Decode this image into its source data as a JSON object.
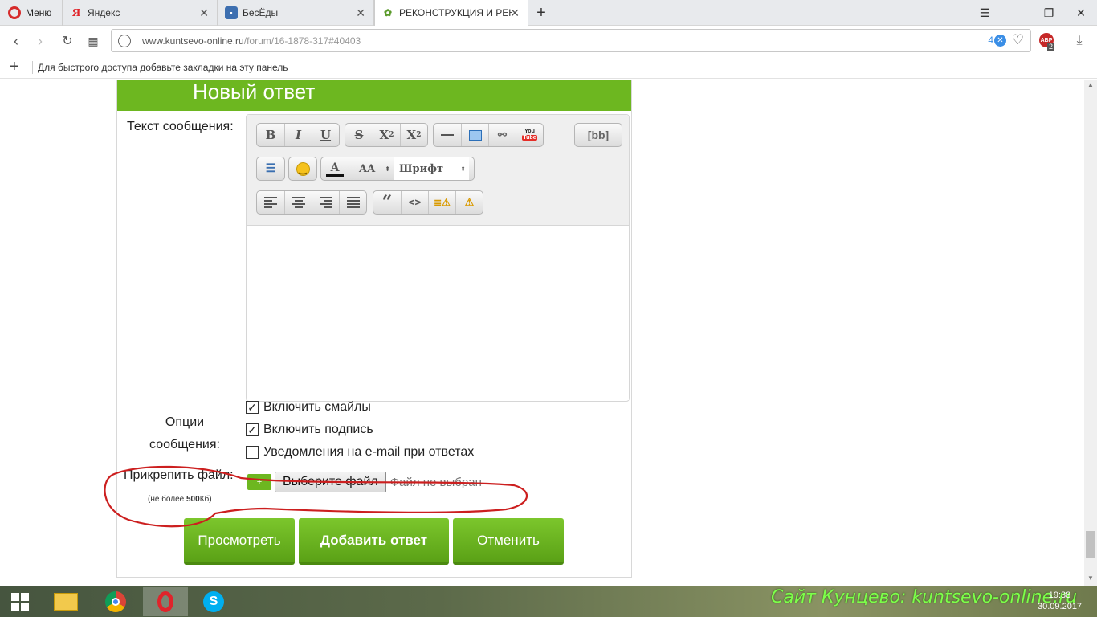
{
  "browser": {
    "menu_label": "Меню",
    "tabs": [
      {
        "label": "Яндекс"
      },
      {
        "label": "БесЁды"
      },
      {
        "label": "РЕКОНСТРУКЦИЯ И РЕНС"
      }
    ],
    "url_host": "www.kuntsevo-online.ru",
    "url_path": "/forum/16-1878-317#40403",
    "adblock_count": "4",
    "abp_badge": "ABP",
    "abp_count": "2",
    "bookmarks_hint": "Для быстрого доступа добавьте закладки на эту панель"
  },
  "form": {
    "header": "Новый ответ",
    "message_label": "Текст сообщения:",
    "toolbar": {
      "bold": "B",
      "italic": "I",
      "underline": "U",
      "strike": "S",
      "superscript": "X",
      "sup_mark": "2",
      "subscript": "X",
      "sub_mark": "2",
      "bb_mode": "[bb]",
      "font_size_label": "AA",
      "font_select": "Шрифт",
      "youtube_top": "You",
      "youtube_bottom": "Tube",
      "code": "<>"
    },
    "options_label_1": "Опции",
    "options_label_2": "сообщения:",
    "options": [
      {
        "label": "Включить смайлы",
        "checked": true
      },
      {
        "label": "Включить подпись",
        "checked": true
      },
      {
        "label": "Уведомления на e-mail при ответах",
        "checked": false
      }
    ],
    "attach_label": "Прикрепить файл:",
    "attach_limit_prefix": "(не более ",
    "attach_limit_value": "500",
    "attach_limit_suffix": "Кб)",
    "attach_plus": "+",
    "choose_file": "Выберите файл",
    "no_file": "Файл не выбран",
    "buttons": {
      "preview": "Просмотреть",
      "submit": "Добавить ответ",
      "cancel": "Отменить"
    }
  },
  "taskbar": {
    "watermark": "Сайт Кунцево: kuntsevo-online.ru",
    "time": "19:38",
    "date": "30.09.2017"
  }
}
